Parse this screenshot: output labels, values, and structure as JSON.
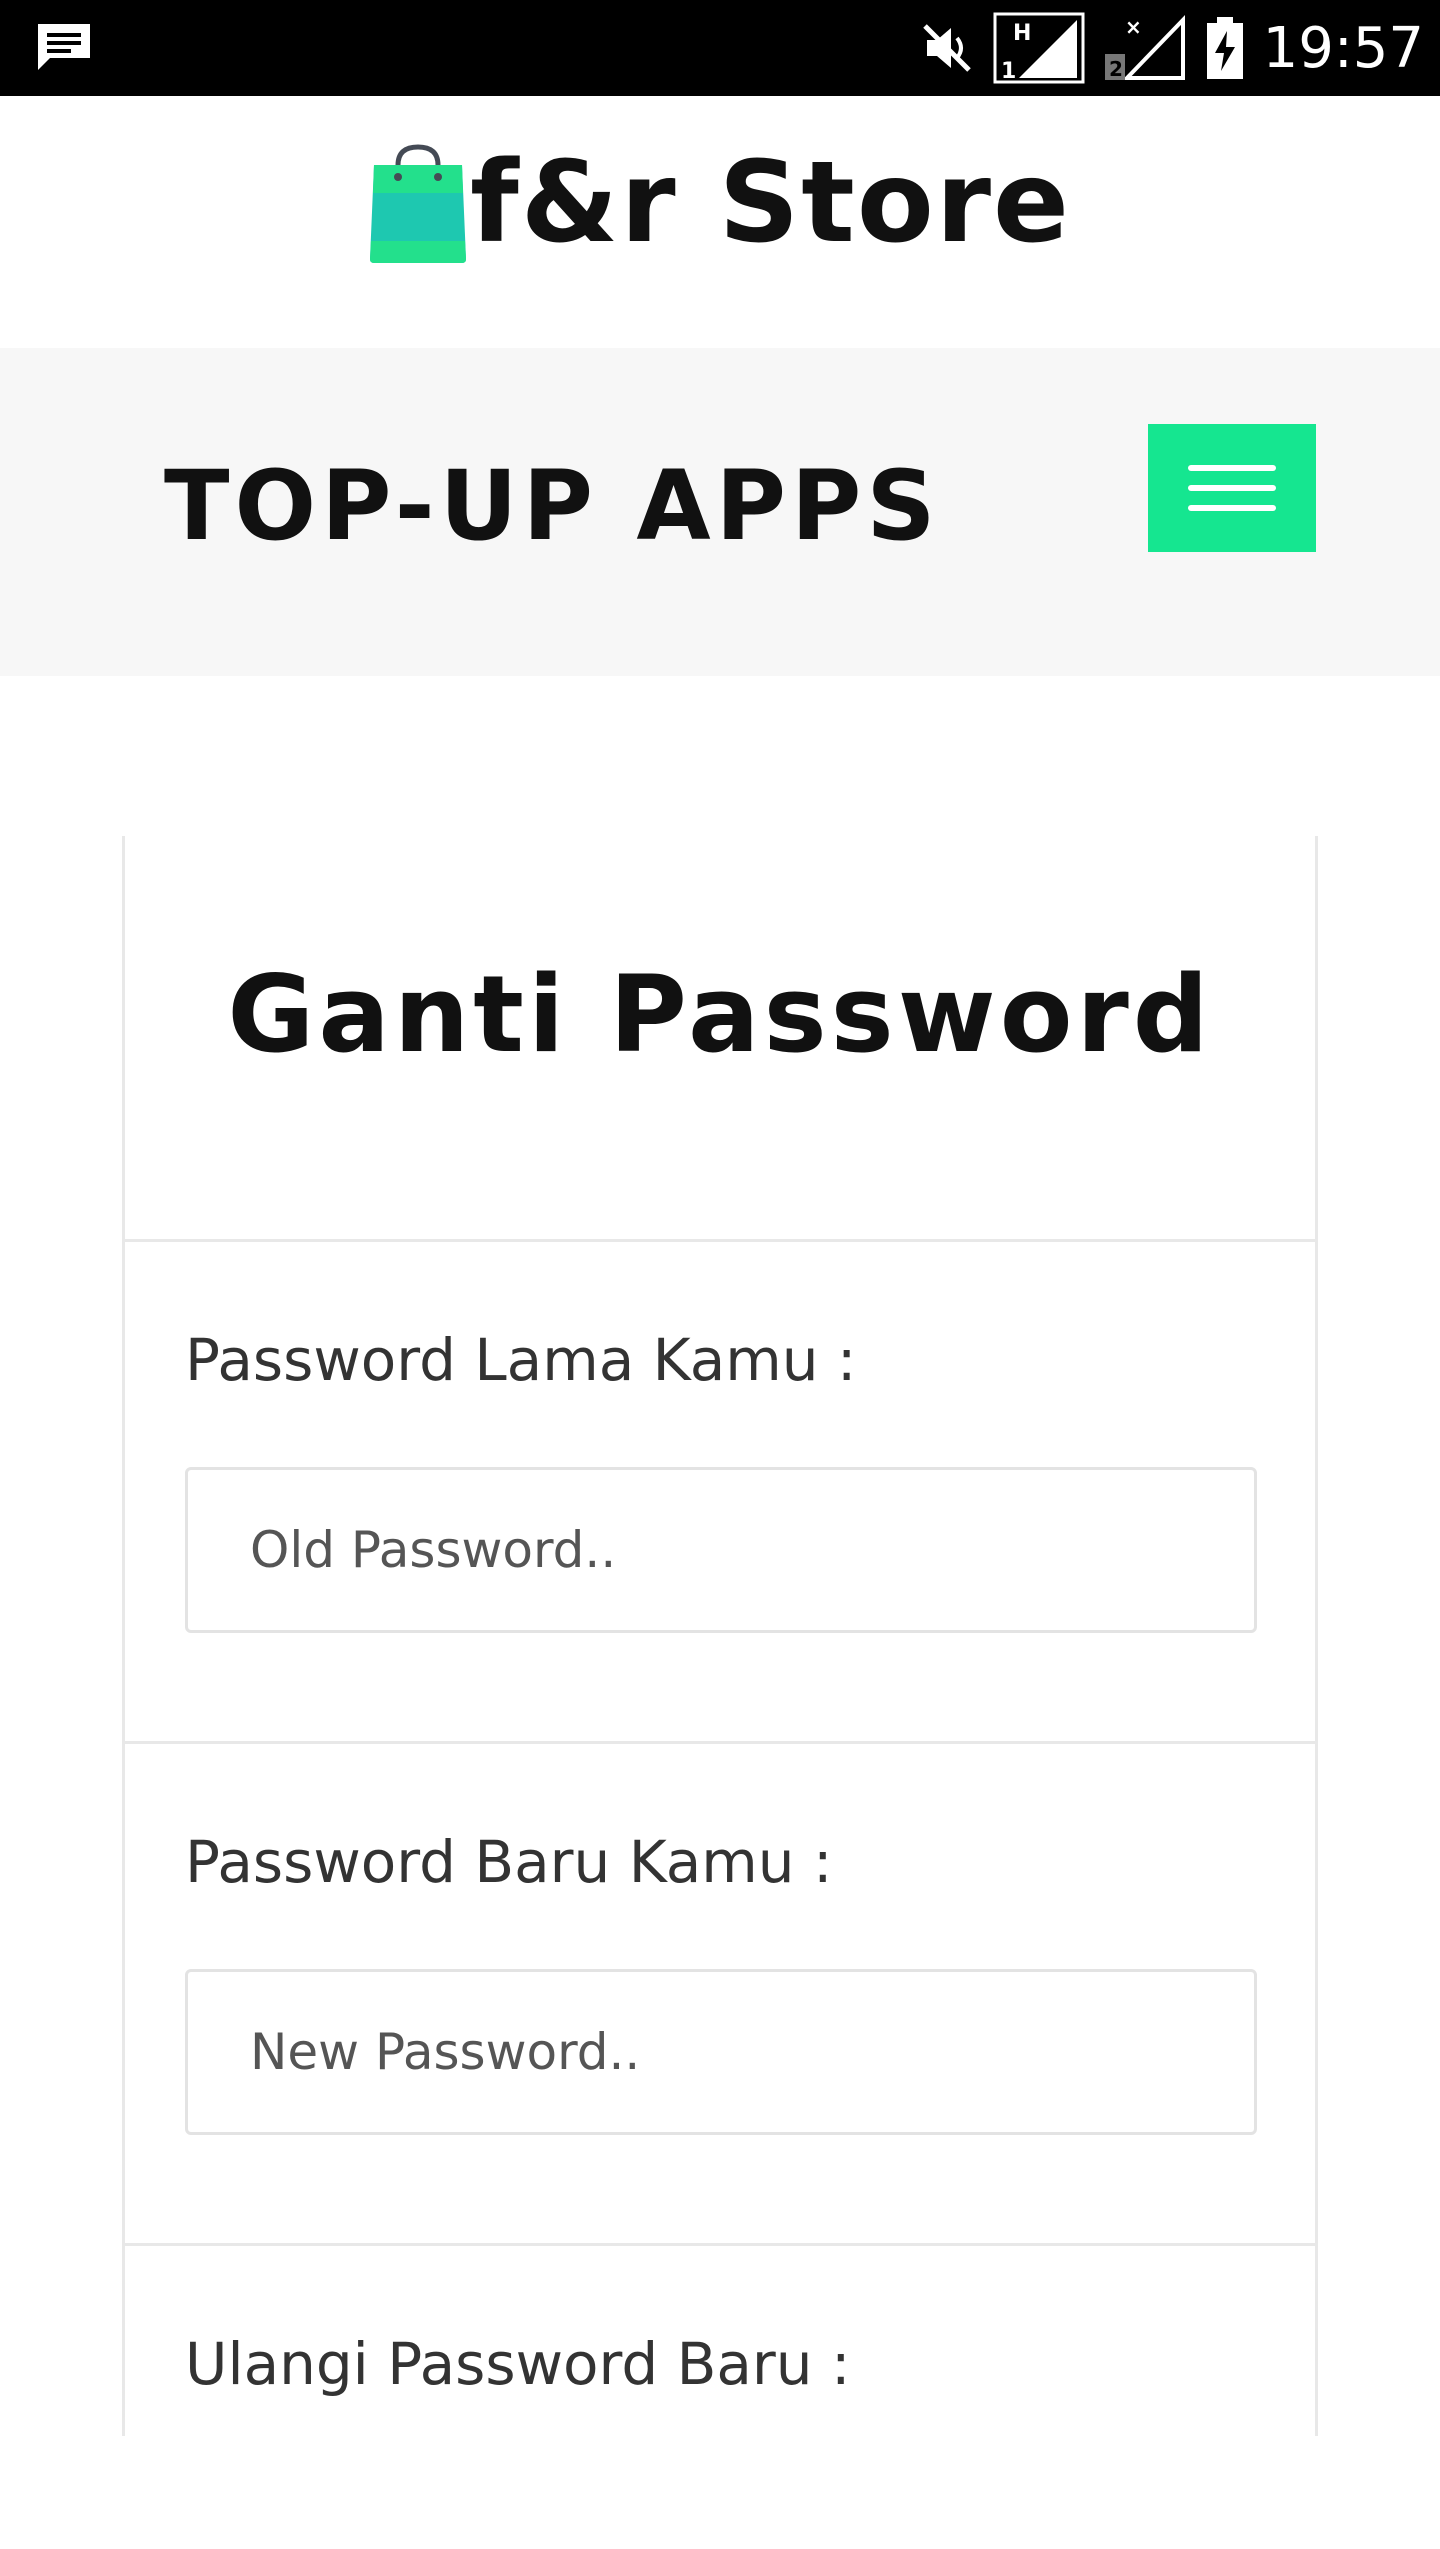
{
  "status_bar": {
    "time": "19:57",
    "icons": [
      "message-icon",
      "mute-icon",
      "signal-h-sim1-icon",
      "signal-sim2-no-data-icon",
      "battery-charging-icon"
    ],
    "sim1_label": "1",
    "sim1_network": "H",
    "sim2_label": "2"
  },
  "header": {
    "logo_icon": "shopping-bag-icon",
    "store_name": "f&r Store"
  },
  "nav": {
    "title": "TOP-UP APPS",
    "menu_icon": "hamburger-menu-icon",
    "menu_color": "#15e690"
  },
  "form": {
    "title": "Ganti Password",
    "fields": [
      {
        "label": "Password Lama Kamu :",
        "placeholder": "Old Password..",
        "value": ""
      },
      {
        "label": "Password Baru Kamu :",
        "placeholder": "New Password..",
        "value": ""
      },
      {
        "label": "Ulangi Password Baru :"
      }
    ]
  }
}
